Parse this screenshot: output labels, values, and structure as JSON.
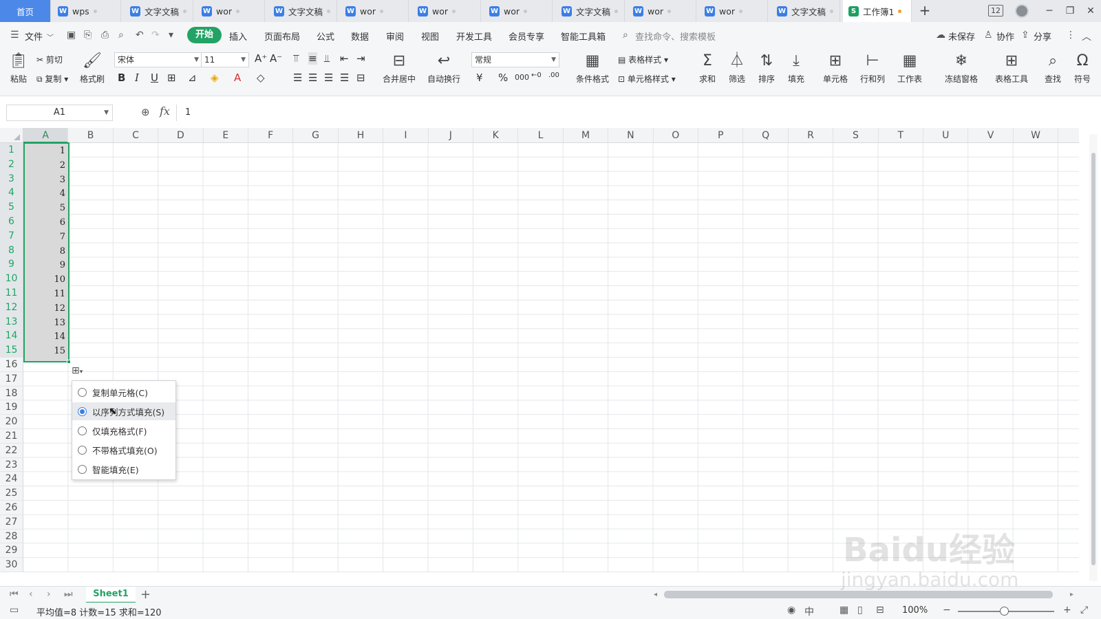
{
  "tabs": {
    "home": "首页",
    "docs": [
      {
        "label": "wps",
        "type": "W"
      },
      {
        "label": "文字文稿",
        "type": "W"
      },
      {
        "label": "wor",
        "type": "W"
      },
      {
        "label": "文字文稿",
        "type": "W"
      },
      {
        "label": "wor",
        "type": "W"
      },
      {
        "label": "wor",
        "type": "W"
      },
      {
        "label": "wor",
        "type": "W"
      },
      {
        "label": "文字文稿",
        "type": "W"
      },
      {
        "label": "wor",
        "type": "W"
      },
      {
        "label": "wor",
        "type": "W"
      },
      {
        "label": "文字文稿",
        "type": "W"
      }
    ],
    "active": {
      "label": "工作簿1",
      "type": "S"
    },
    "new_tab": "+",
    "badge": "12"
  },
  "menu": {
    "file": "文件",
    "items": [
      "开始",
      "插入",
      "页面布局",
      "公式",
      "数据",
      "审阅",
      "视图",
      "开发工具",
      "会员专享",
      "智能工具箱"
    ],
    "active_index": 0,
    "search_placeholder": "查找命令、搜索模板",
    "unsaved": "未保存",
    "collab": "协作",
    "share": "分享"
  },
  "ribbon": {
    "paste": "粘贴",
    "cut": "剪切",
    "copy": "复制",
    "format_painter": "格式刷",
    "font_name": "宋体",
    "font_size": "11",
    "merge_center": "合并居中",
    "wrap_text": "自动换行",
    "number_format": "常规",
    "cond_format": "条件格式",
    "table_style": "表格样式",
    "cell_style": "单元格样式",
    "sum": "求和",
    "filter": "筛选",
    "sort": "排序",
    "fill": "填充",
    "cell": "单元格",
    "row_col": "行和列",
    "worksheet": "工作表",
    "freeze": "冻结窗格",
    "table_tools": "表格工具",
    "find": "查找",
    "symbol": "符号"
  },
  "formula_bar": {
    "name_box": "A1",
    "fx": "fx",
    "value": "1"
  },
  "grid": {
    "columns": [
      "A",
      "B",
      "C",
      "D",
      "E",
      "F",
      "G",
      "H",
      "I",
      "J",
      "K",
      "L",
      "M",
      "N",
      "O",
      "P",
      "Q",
      "R",
      "S",
      "T",
      "U",
      "V",
      "W"
    ],
    "rows": [
      "1",
      "2",
      "3",
      "4",
      "5",
      "6",
      "7",
      "8",
      "9",
      "10",
      "11",
      "12",
      "13",
      "14",
      "15",
      "16",
      "17",
      "18",
      "19",
      "20",
      "21",
      "22",
      "23",
      "24",
      "25",
      "26",
      "27",
      "28",
      "29",
      "30"
    ],
    "column_a_values": [
      "1",
      "2",
      "3",
      "4",
      "5",
      "6",
      "7",
      "8",
      "9",
      "10",
      "11",
      "12",
      "13",
      "14",
      "15"
    ],
    "selected_range": "A1:A15"
  },
  "autofill_menu": {
    "options": [
      "复制单元格(C)",
      "以序列方式填充(S)",
      "仅填充格式(F)",
      "不带格式填充(O)",
      "智能填充(E)"
    ],
    "selected_index": 1
  },
  "sheets": {
    "tabs": [
      "Sheet1"
    ],
    "active": "Sheet1",
    "add": "+"
  },
  "status": {
    "summary": "平均值=8  计数=15  求和=120",
    "zoom": "100%"
  },
  "watermark": {
    "brand": "Baidu经验",
    "url": "jingyan.baidu.com"
  },
  "colors": {
    "accent": "#22a365",
    "home_tab": "#4c88e8",
    "selection_fill": "#d9d9d9"
  }
}
